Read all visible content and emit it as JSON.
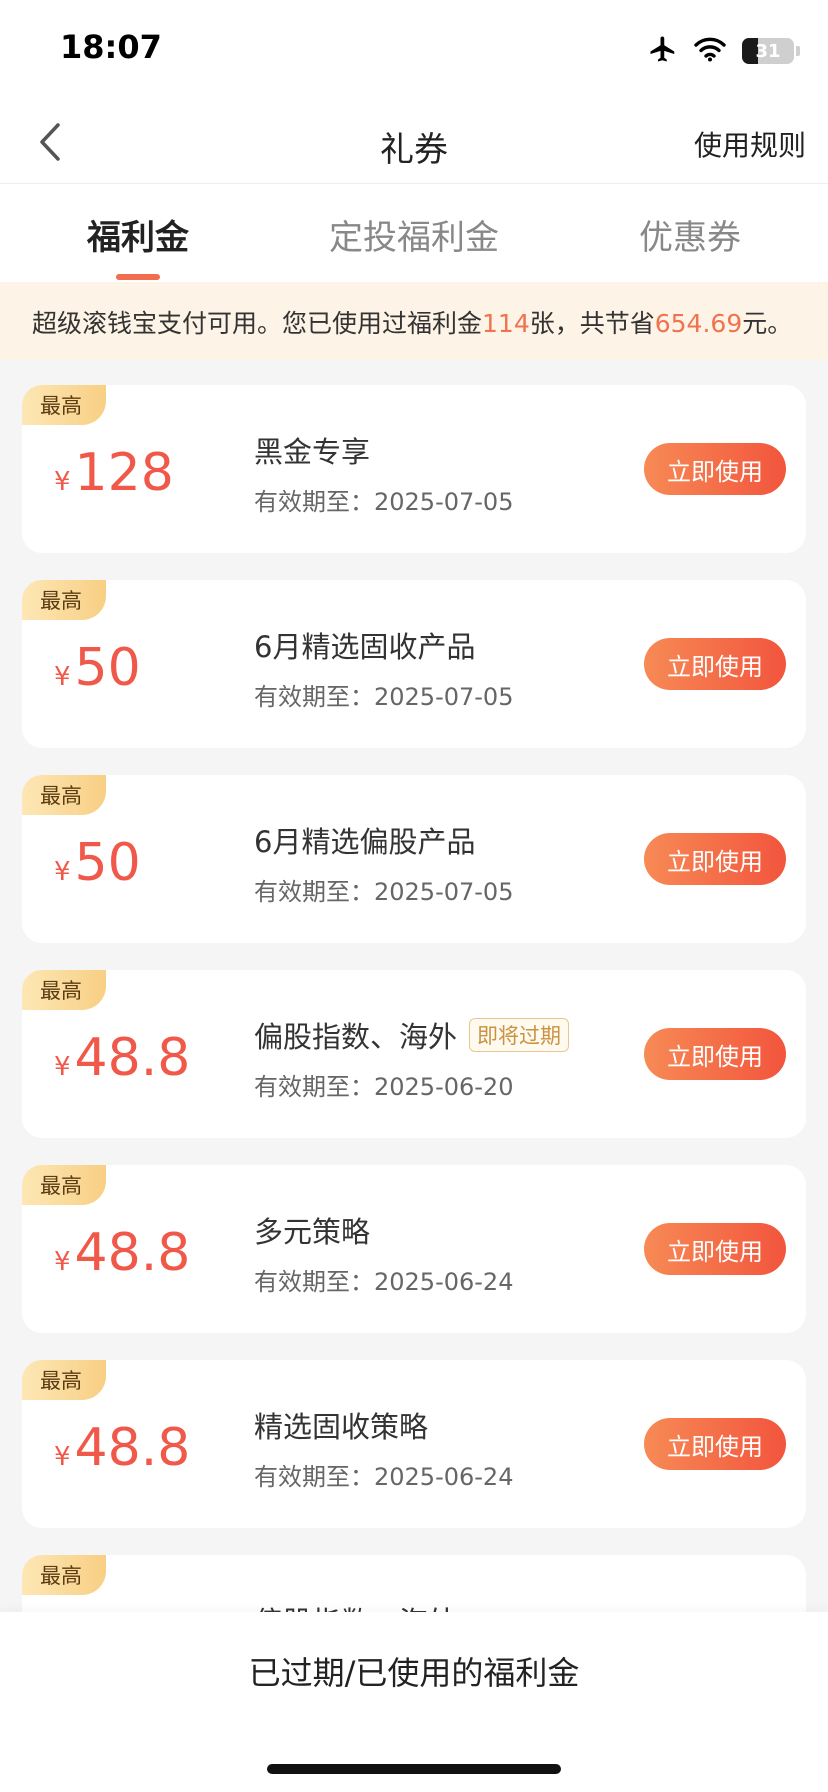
{
  "status_bar": {
    "time": "18:07",
    "battery": "31",
    "battery_level": 0.31,
    "icons": [
      "airplane-icon",
      "wifi-icon",
      "battery-icon"
    ]
  },
  "nav": {
    "back_icon": "chevron-left-icon",
    "title": "礼券",
    "rules_link": "使用规则"
  },
  "tabs": [
    {
      "label": "福利金",
      "active": true
    },
    {
      "label": "定投福利金",
      "active": false
    },
    {
      "label": "优惠券",
      "active": false
    }
  ],
  "notice": {
    "text_prefix": "超级滚钱宝支付可用。您已使用过福利金",
    "used_count": "114",
    "text_middle": "张，共节省",
    "saved_amount": "654.69",
    "text_suffix": "元。"
  },
  "coupons": [
    {
      "badge": "最高",
      "currency": "¥",
      "amount": "128",
      "title": "黑金专享",
      "expiry_tag": "",
      "expiry": "有效期至：2025-07-05",
      "button": "立即使用"
    },
    {
      "badge": "最高",
      "currency": "¥",
      "amount": "50",
      "title": "6月精选固收产品",
      "expiry_tag": "",
      "expiry": "有效期至：2025-07-05",
      "button": "立即使用"
    },
    {
      "badge": "最高",
      "currency": "¥",
      "amount": "50",
      "title": "6月精选偏股产品",
      "expiry_tag": "",
      "expiry": "有效期至：2025-07-05",
      "button": "立即使用"
    },
    {
      "badge": "最高",
      "currency": "¥",
      "amount": "48.8",
      "title": "偏股指数、海外",
      "expiry_tag": "即将过期",
      "expiry": "有效期至：2025-06-20",
      "button": "立即使用"
    },
    {
      "badge": "最高",
      "currency": "¥",
      "amount": "48.8",
      "title": "多元策略",
      "expiry_tag": "",
      "expiry": "有效期至：2025-06-24",
      "button": "立即使用"
    },
    {
      "badge": "最高",
      "currency": "¥",
      "amount": "48.8",
      "title": "精选固收策略",
      "expiry_tag": "",
      "expiry": "有效期至：2025-06-24",
      "button": "立即使用"
    },
    {
      "badge": "最高",
      "currency": "",
      "amount": "",
      "title": "偏股指数、海外",
      "expiry_tag": "",
      "expiry": "",
      "button": ""
    }
  ],
  "bottom": {
    "history_link": "已过期/已使用的福利金"
  },
  "colors": {
    "accent": "#f26c4f",
    "amount": "#f0584a",
    "notice_bg": "#fdf3e6",
    "badge": "#f8cf84"
  }
}
